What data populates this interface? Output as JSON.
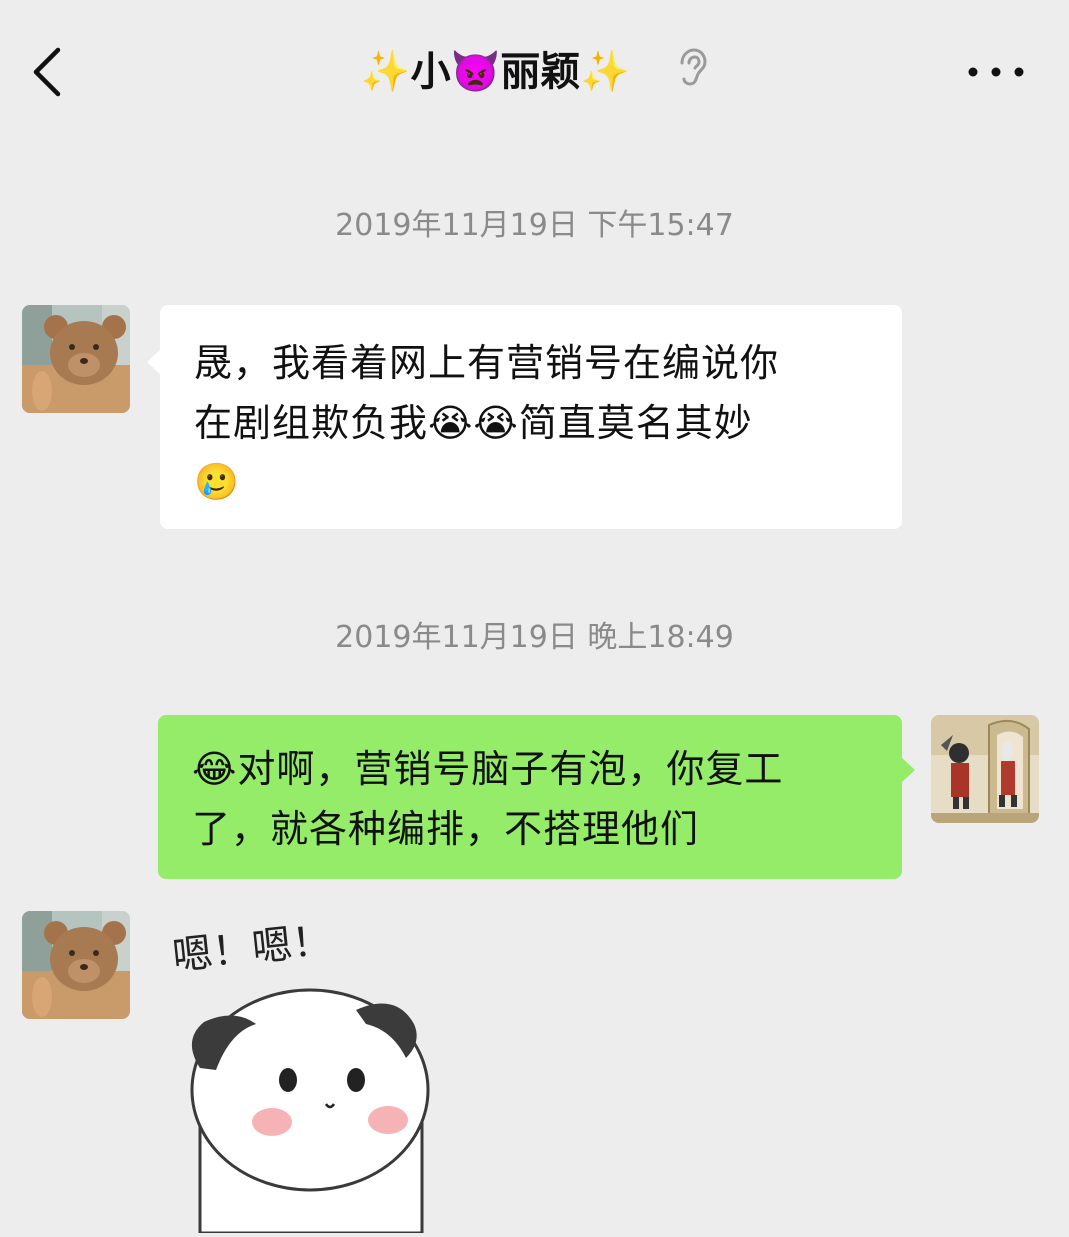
{
  "header": {
    "title": "✨小👿丽颖✨",
    "back_icon": "chevron-left-icon",
    "ear_icon": "earpiece-icon",
    "more_icon": "more-horizontal-icon"
  },
  "messages": [
    {
      "timestamp": "2019年11月19日 下午15:47",
      "direction": "in",
      "line1": "晟，我看着网上有营销号在编说你",
      "line2": "在剧组欺负我😭😭简直莫名其妙",
      "line3": "🥲"
    },
    {
      "timestamp": "2019年11月19日 晚上18:49",
      "direction": "out",
      "line1": "😂对啊，营销号脑子有泡，你复工",
      "line2": "了，就各种编排，不搭理他们"
    },
    {
      "direction": "in",
      "sticker_text": "嗯！嗯！"
    }
  ],
  "colors": {
    "background": "#ededed",
    "incoming_bubble": "#ffffff",
    "outgoing_bubble": "#95ec69",
    "timestamp": "#8a8a8a"
  }
}
